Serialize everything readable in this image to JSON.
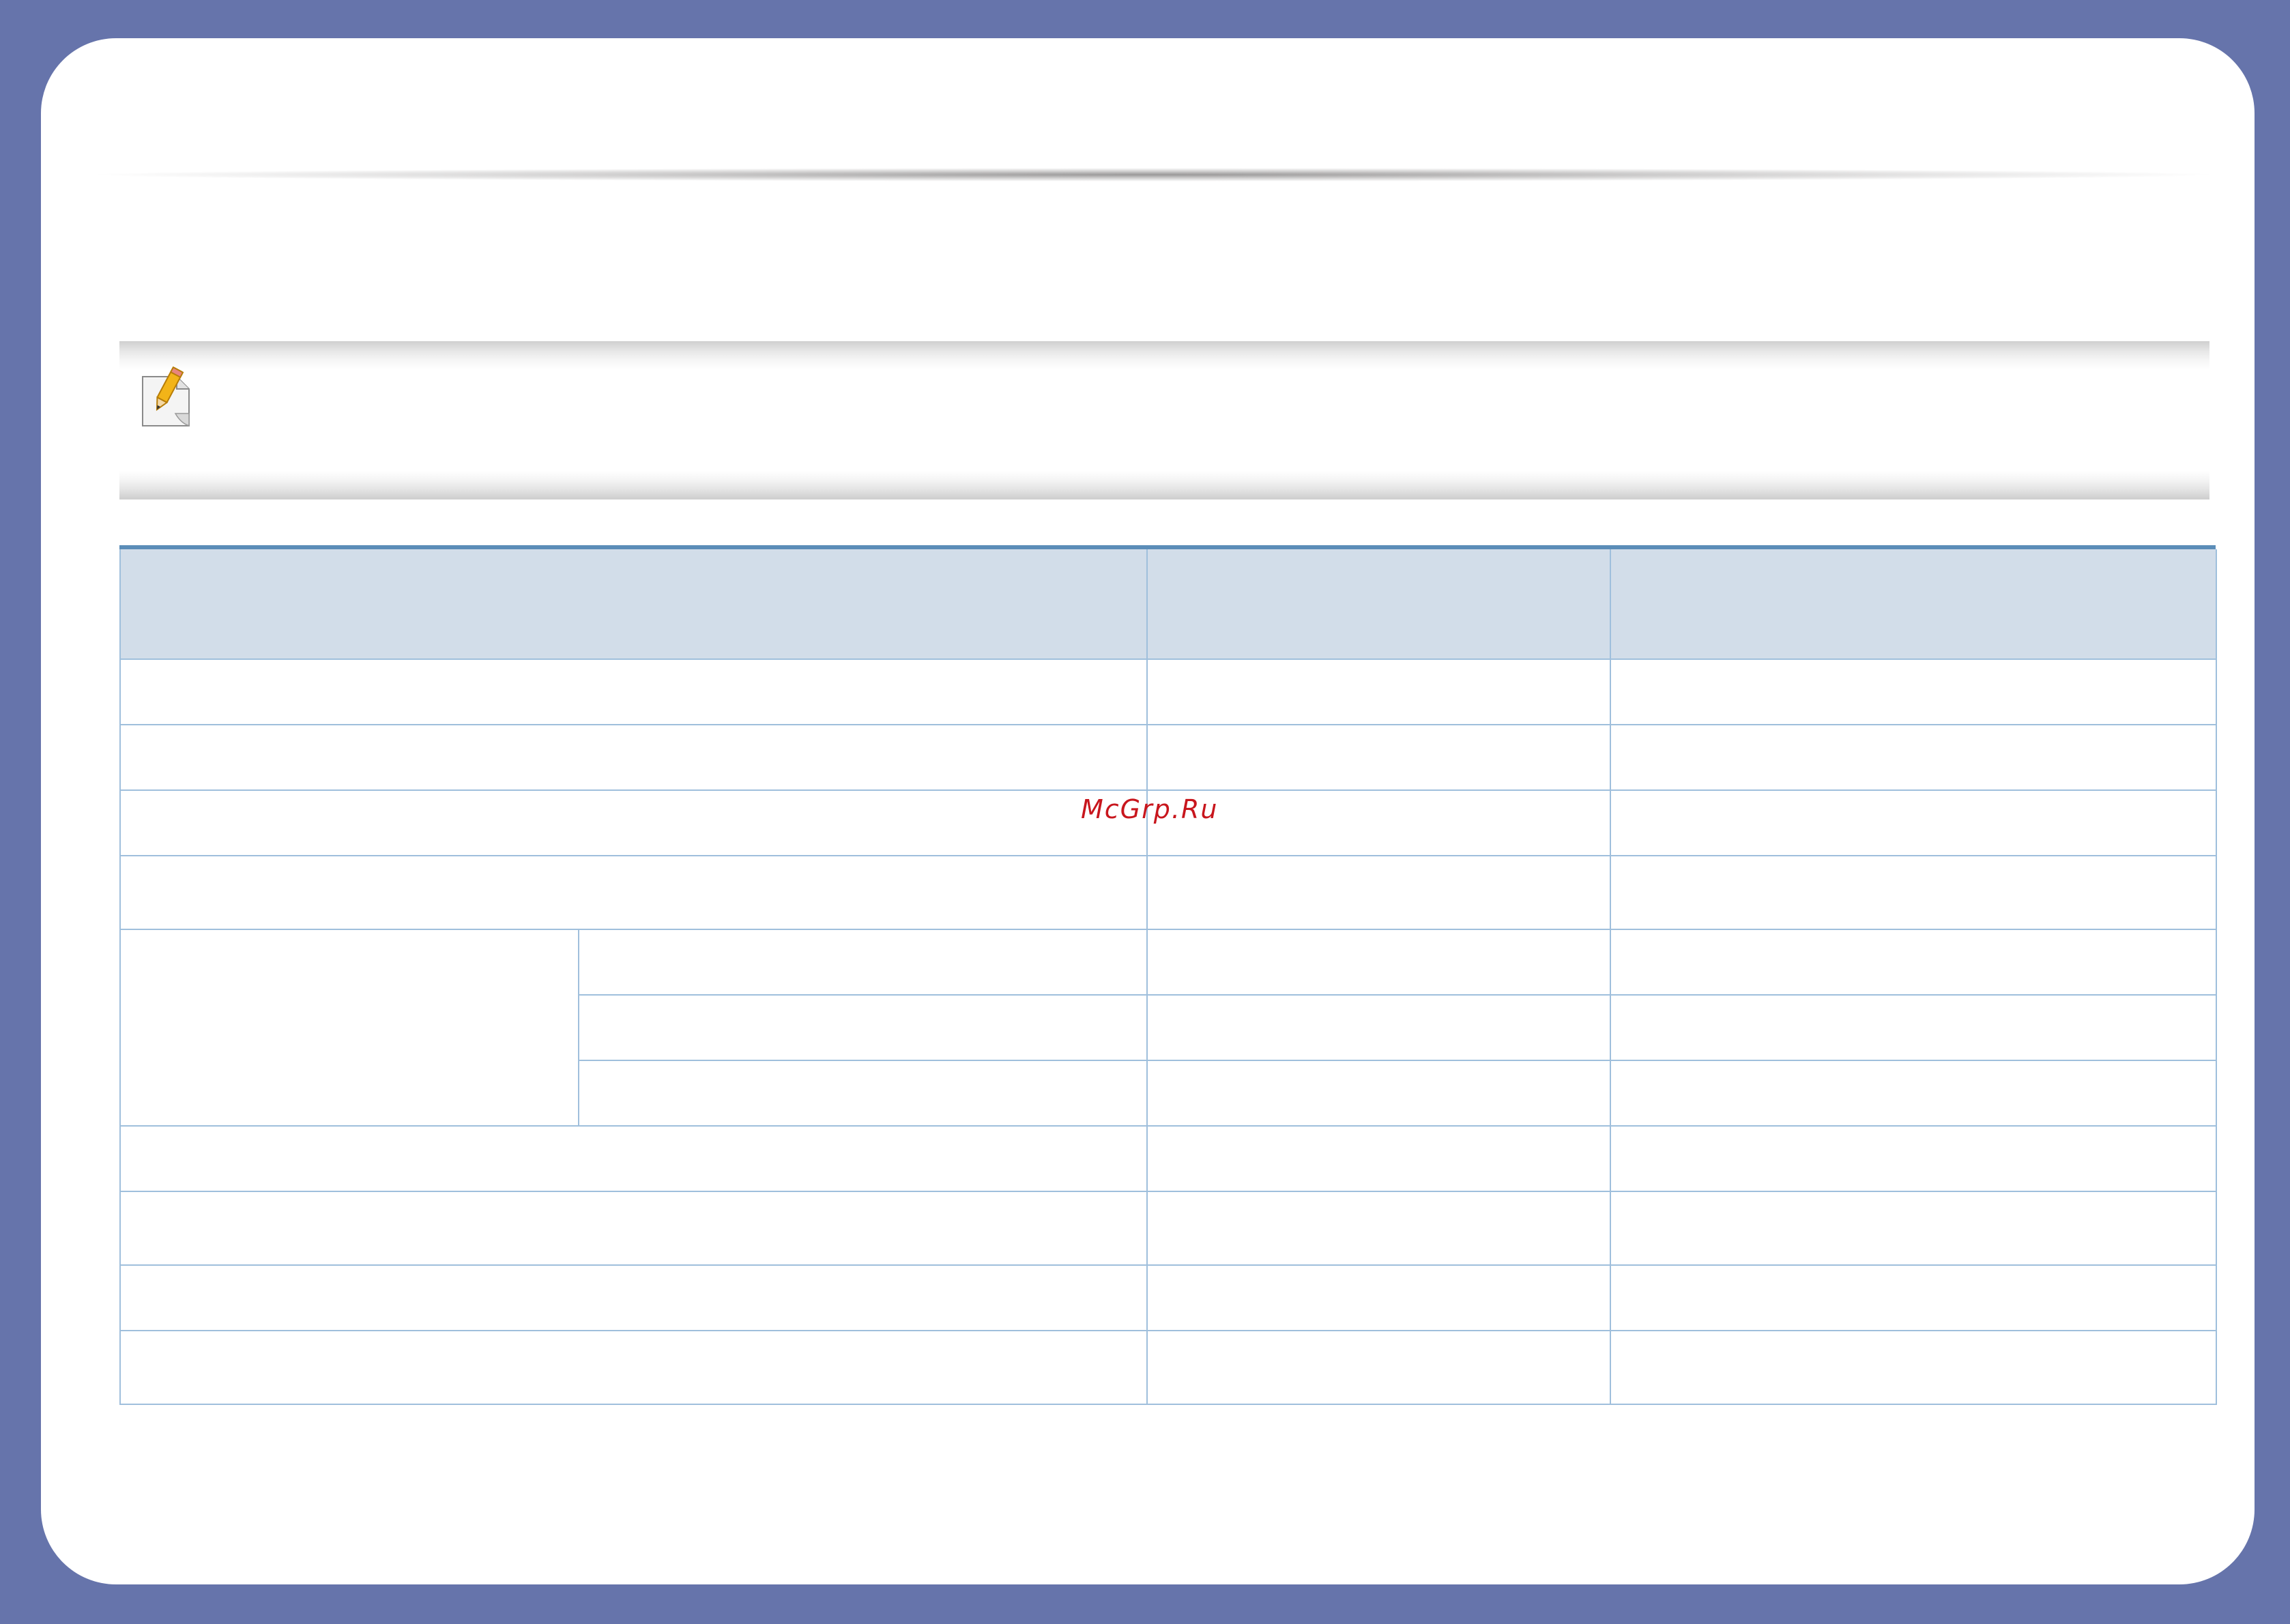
{
  "watermark": {
    "text": "McGrp.Ru"
  },
  "note": {
    "icon": "note-pencil-icon"
  },
  "colors": {
    "background": "#6674ab",
    "table_header": "#d2dde9",
    "table_border": "#9fbfdc",
    "table_rule": "#5b8db8",
    "watermark": "#c8161d"
  }
}
